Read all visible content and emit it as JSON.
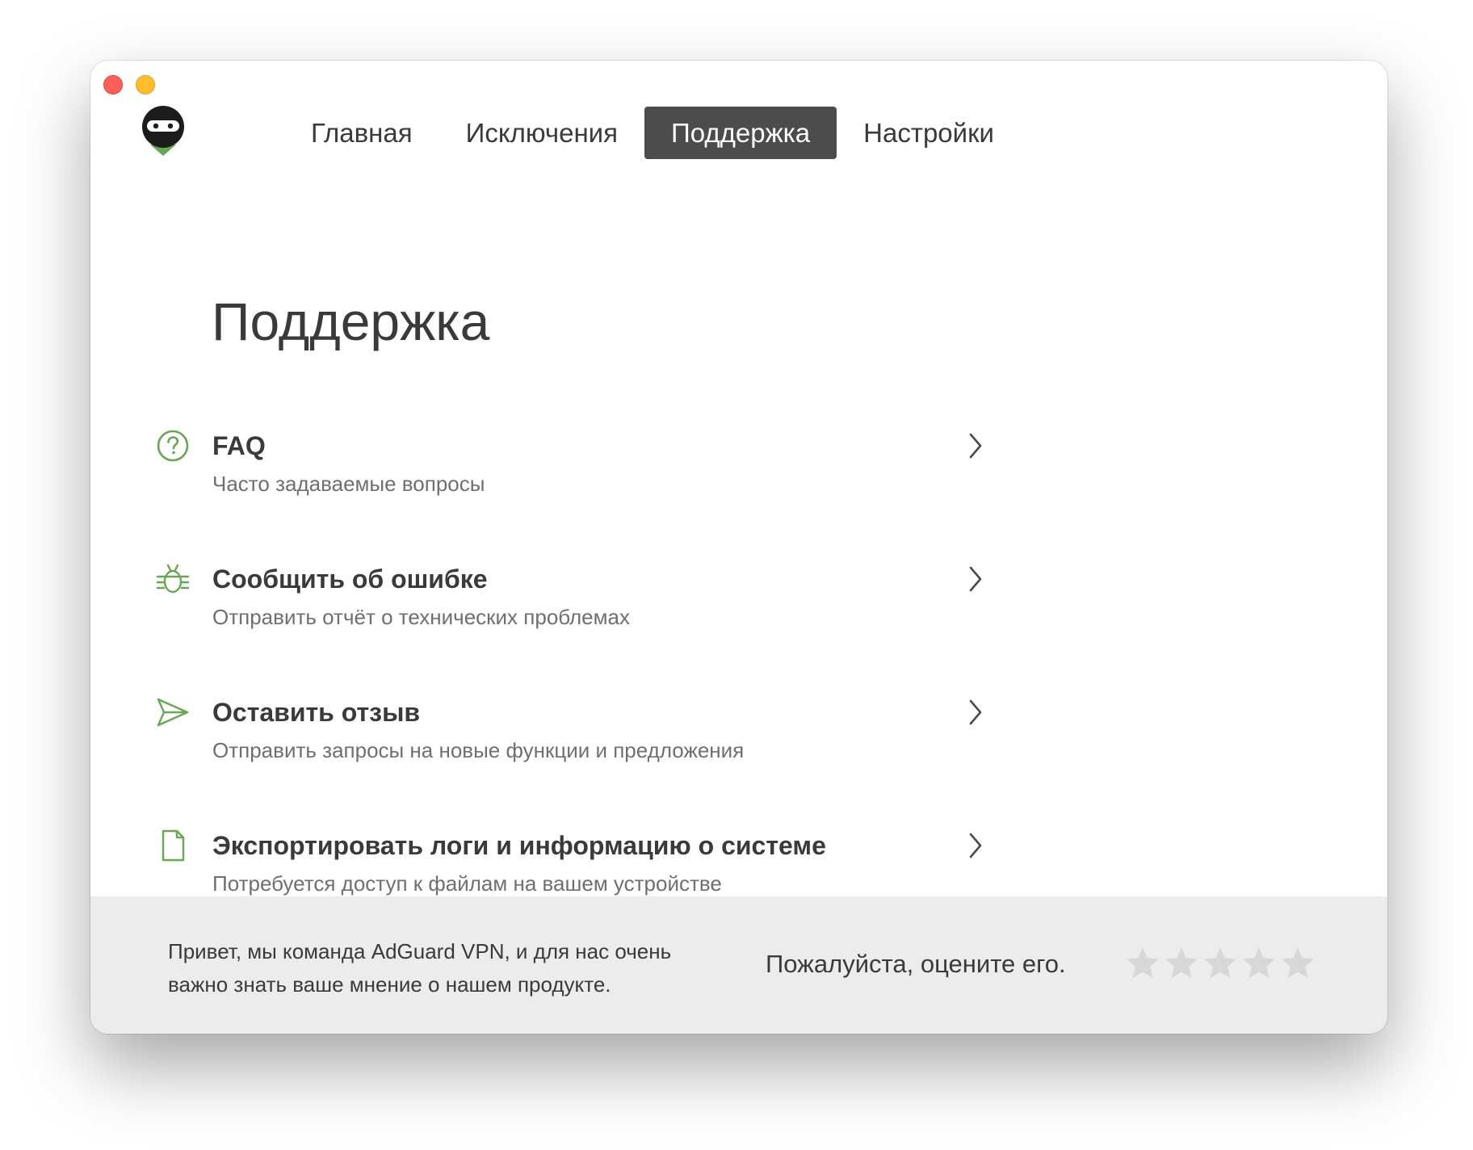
{
  "nav": {
    "items": [
      {
        "label": "Главная",
        "active": false
      },
      {
        "label": "Исключения",
        "active": false
      },
      {
        "label": "Поддержка",
        "active": true
      },
      {
        "label": "Настройки",
        "active": false
      }
    ]
  },
  "page": {
    "title": "Поддержка"
  },
  "support_items": [
    {
      "icon": "question-circle-icon",
      "title": "FAQ",
      "subtitle": "Часто задаваемые вопросы"
    },
    {
      "icon": "bug-icon",
      "title": "Сообщить об ошибке",
      "subtitle": "Отправить отчёт о технических проблемах"
    },
    {
      "icon": "paper-plane-icon",
      "title": "Оставить отзыв",
      "subtitle": "Отправить запросы на новые функции и предложения"
    },
    {
      "icon": "document-icon",
      "title": "Экспортировать логи и информацию о системе",
      "subtitle": "Потребуется доступ к файлам на вашем устройстве"
    }
  ],
  "footer": {
    "message_line1": "Привет, мы команда AdGuard VPN, и для нас очень",
    "message_line2": "важно знать ваше мнение о нашем продукте.",
    "rate_label": "Пожалуйста, оцените его.",
    "rating": 0,
    "max_rating": 5
  },
  "colors": {
    "accent_green": "#67a653",
    "nav_active_bg": "#4c4c4c",
    "footer_bg": "#ececec",
    "star_empty": "#d7d7d7"
  }
}
